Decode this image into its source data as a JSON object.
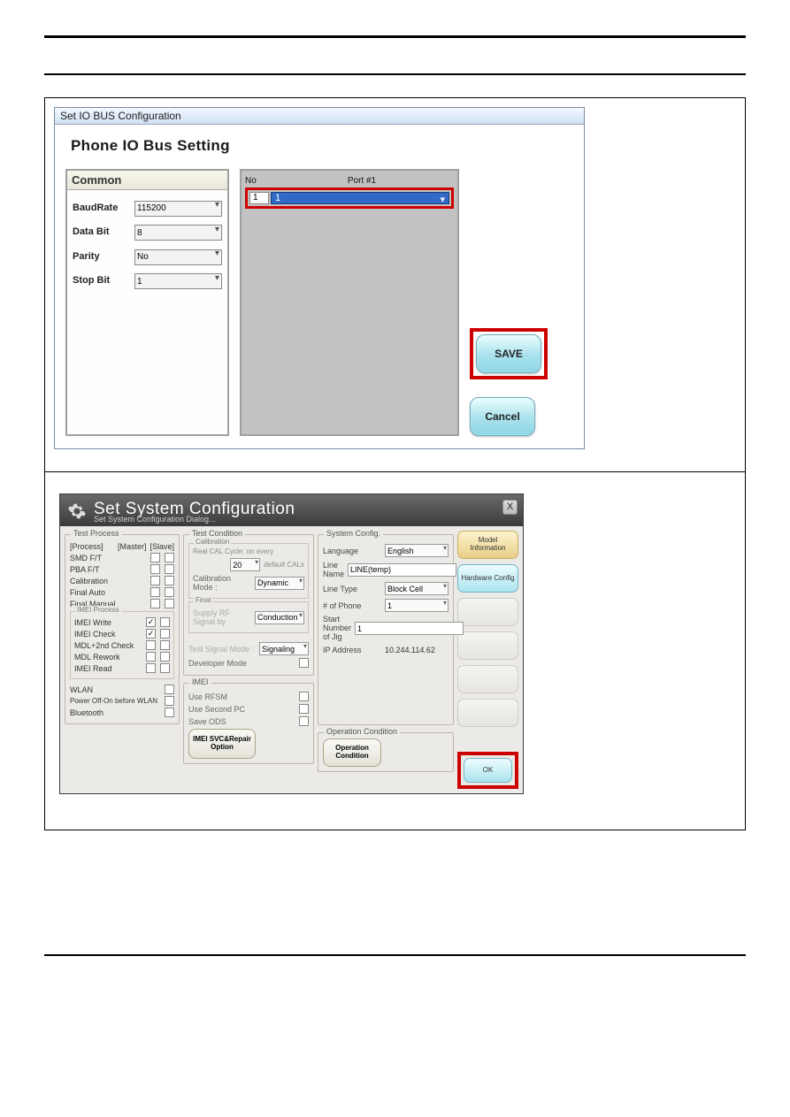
{
  "io": {
    "window_title": "Set IO BUS Configuration",
    "heading": "Phone IO Bus Setting",
    "common_title": "Common",
    "fields": {
      "baudrate_label": "BaudRate",
      "baudrate_value": "115200",
      "databit_label": "Data Bit",
      "databit_value": "8",
      "parity_label": "Parity",
      "parity_value": "No",
      "stopbit_label": "Stop Bit",
      "stopbit_value": "1"
    },
    "port_no_header": "No",
    "port_header": "Port #1",
    "port_no_value": "1",
    "port_value": "1",
    "save": "SAVE",
    "cancel": "Cancel"
  },
  "sys": {
    "title": "Set System Configuration",
    "subtitle": "Set System Configuration Dialog...",
    "close": "X",
    "tp": {
      "legend": "Test Process",
      "col_process": "[Process]",
      "col_master": "[Master]",
      "col_slave": "[Slave]",
      "rows": [
        "SMD F/T",
        "PBA F/T",
        "Calibration",
        "Final Auto",
        "Final Manual"
      ],
      "imei_legend": "IMEI Process",
      "imei_rows": [
        "IMEI Write",
        "IMEI Check",
        "MDL+2nd Check",
        "MDL Rework",
        "IMEI Read"
      ],
      "wlan": "WLAN",
      "poweroff": "Power Off-On before WLAN",
      "bluetooth": "Bluetooth"
    },
    "tc": {
      "legend": "Test Condition",
      "cal_legend": "Calibration",
      "cal_text1": "Real CAL Cycle: on every",
      "cal_num": "20",
      "cal_text2": "default CALs",
      "calmode_label": "Calibration Mode :",
      "calmode_value": "Dynamic",
      "final_legend": "Final",
      "supply_label": "Supply RF Signal by",
      "supply_value": "Conduction",
      "tsm_label": "Test Signal Mode :",
      "tsm_value": "Signaling",
      "dev_label": "Developer Mode",
      "imei_legend": "IMEI",
      "use_rfsm": "Use RFSM",
      "use_second": "Use Second PC",
      "save_ods": "Save ODS",
      "imei_btn": "IMEI SVC&Repair Option"
    },
    "sc": {
      "legend": "System Config.",
      "lang_label": "Language",
      "lang_value": "English",
      "linename_label": "Line Name",
      "linename_value": "LINE(temp)",
      "linetype_label": "Line Type",
      "linetype_value": "Block Cell",
      "phone_label": "# of Phone",
      "phone_value": "1",
      "startjig_label": "Start Number of Jig",
      "startjig_value": "1",
      "ip_label": "IP Address",
      "ip_value": "10.244.114.62"
    },
    "oc": {
      "legend": "Operation Condition",
      "btn": "Operation Condition"
    },
    "rbtns": {
      "model": "Model Information",
      "hw": "Hardware Config",
      "d1": " ",
      "d2": " ",
      "d3": " ",
      "d4": " ",
      "ok": "OK"
    }
  }
}
